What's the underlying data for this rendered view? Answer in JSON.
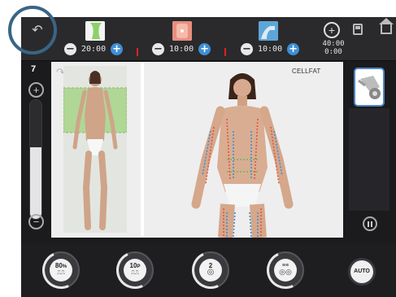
{
  "toolbar": {
    "zones": [
      {
        "time": "20:00"
      },
      {
        "time": "10:00"
      },
      {
        "time": "10:00"
      }
    ],
    "total_time": "40:00",
    "elapsed_time": "0:00"
  },
  "left_panel": {
    "intensity_value": "7",
    "intensity_level": 0.6
  },
  "main": {
    "program_label": "CELLFAT"
  },
  "controls": {
    "power_value": "80",
    "power_unit": "%",
    "frequency_value": "10",
    "frequency_unit": "P",
    "mode_value": "2",
    "auto_label": "AUTO"
  },
  "colors": {
    "accent": "#3f8fd6",
    "zone_highlight": "#8fd06a",
    "timeline_marker": "#dd2222",
    "head_card_border": "#4d86c4"
  }
}
